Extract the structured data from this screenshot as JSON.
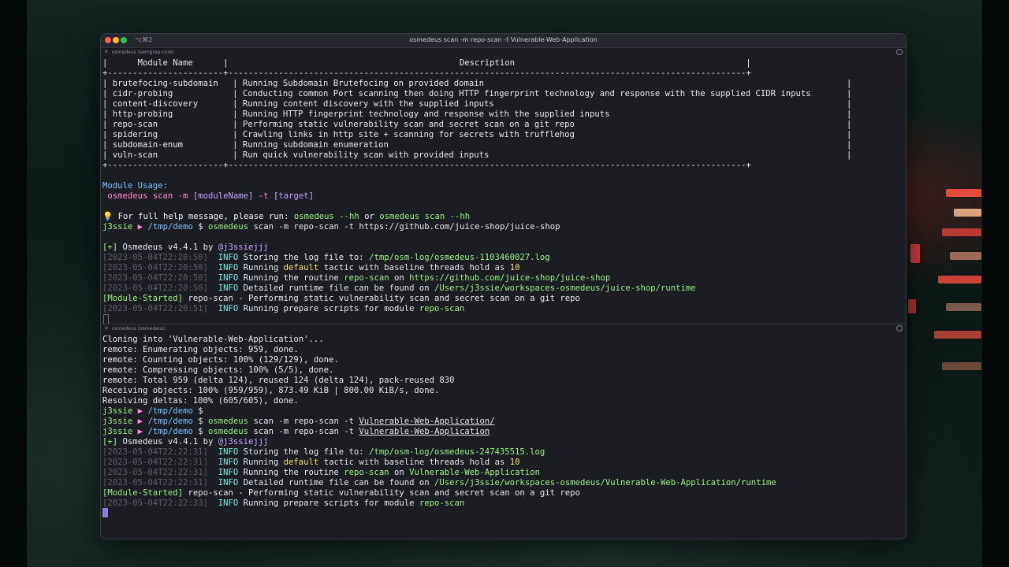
{
  "window": {
    "shortcut": "⌥⌘2",
    "title": "osmedeus scan -m repo-scan -t Vulnerable-Web-Application"
  },
  "pane1": {
    "name": "osmedeus (semgrep-core)",
    "table": {
      "border_top": "|      Module Name      |                                              Description                                              |",
      "separator": "+-----------------------+-------------------------------------------------------------------------------------------------------+",
      "rows": [
        {
          "name": "brutefocing-subdomain",
          "desc": "Running Subdomain Brutefocing on provided domain"
        },
        {
          "name": "cidr-probing",
          "desc": "Conducting common Port scanning then doing HTTP fingerprint technology and response with the supplied CIDR inputs"
        },
        {
          "name": "content-discovery",
          "desc": "Running content discovery with the supplied inputs"
        },
        {
          "name": "http-probing",
          "desc": "Running HTTP fingerprint technology and response with the supplied inputs"
        },
        {
          "name": "repo-scan",
          "desc": "Performing static vulnerability scan and secret scan on a git repo"
        },
        {
          "name": "spidering",
          "desc": "Crawling links in http site + scanning for secrets with trufflehog"
        },
        {
          "name": "subdomain-enum",
          "desc": "Running subdomain enumeration"
        },
        {
          "name": "vuln-scan",
          "desc": "Run quick vulnerability scan with provided inputs"
        }
      ]
    },
    "usage_label": "Module Usage:",
    "usage_cmd": "osmedeus scan -m",
    "usage_arg1": "[moduleName]",
    "usage_flag": "-t",
    "usage_arg2": "[target]",
    "help_prefix": "💡 For full help message, please run:",
    "help_cmd1": "osmedeus --hh",
    "help_or": "or",
    "help_cmd2": "osmedeus scan --hh",
    "prompt_user": "j3ssie",
    "prompt_arrow": "▶",
    "prompt_dir": "/tmp/demo",
    "prompt_dollar": "$",
    "cmd_name": "osmedeus",
    "cmd_args": "scan -m repo-scan -t https://github.com/juice-shop/juice-shop",
    "banner_plus": "[+]",
    "banner_text": "Osmedeus v4.4.1 by",
    "banner_author": "@j3ssiejjj",
    "logs": [
      {
        "ts": "[2023-05-04T22:20:50]",
        "level": "INFO",
        "pre": "Storing the log file to:",
        "hl": "/tmp/osm-log/osmedeus-1103460027.log",
        "post": ""
      },
      {
        "ts": "[2023-05-04T22:20:50]",
        "level": "INFO",
        "pre": "Running",
        "hl": "default",
        "post": "tactic with baseline threads hold as",
        "num": "10"
      },
      {
        "ts": "[2023-05-04T22:20:50]",
        "level": "INFO",
        "pre": "Running the routine",
        "hl": "repo-scan",
        "post": "on",
        "url": "https://github.com/juice-shop/juice-shop"
      },
      {
        "ts": "[2023-05-04T22:20:50]",
        "level": "INFO",
        "pre": "Detailed runtime file can be found on",
        "hl": "/Users/j3ssie/workspaces-osmedeus/juice-shop/runtime",
        "post": ""
      }
    ],
    "module_started_tag": "[Module-Started]",
    "module_started_text": "repo-scan - Performing static vulnerability scan and secret scan on a git repo",
    "last_log": {
      "ts": "[2023-05-04T22:20:51]",
      "level": "INFO",
      "pre": "Running prepare scripts for module",
      "hl": "repo-scan"
    }
  },
  "pane2": {
    "name": "osmedeus (osmedeus)",
    "git_lines": [
      "Cloning into 'Vulnerable-Web-Application'...",
      "remote: Enumerating objects: 959, done.",
      "remote: Counting objects: 100% (129/129), done.",
      "remote: Compressing objects: 100% (5/5), done.",
      "remote: Total 959 (delta 124), reused 124 (delta 124), pack-reused 830",
      "Receiving objects: 100% (959/959), 873.49 KiB | 800.00 KiB/s, done.",
      "Resolving deltas: 100% (605/605), done."
    ],
    "cmd_args_1": "scan -m repo-scan -t",
    "target_1": "Vulnerable-Web-Application/",
    "target_2": "Vulnerable-Web-Application",
    "banner_plus": "[+]",
    "banner_text": "Osmedeus v4.4.1 by",
    "banner_author": "@j3ssiejjj",
    "logs": [
      {
        "ts": "[2023-05-04T22:22:31]",
        "level": "INFO",
        "pre": "Storing the log file to:",
        "hl": "/tmp/osm-log/osmedeus-247435515.log"
      },
      {
        "ts": "[2023-05-04T22:22:31]",
        "level": "INFO",
        "pre": "Running",
        "hl": "default",
        "post": "tactic with baseline threads hold as",
        "num": "10"
      },
      {
        "ts": "[2023-05-04T22:22:31]",
        "level": "INFO",
        "pre": "Running the routine",
        "hl": "repo-scan",
        "post": "on",
        "url": "Vulnerable-Web-Application"
      },
      {
        "ts": "[2023-05-04T22:22:31]",
        "level": "INFO",
        "pre": "Detailed runtime file can be found on",
        "hl": "/Users/j3ssie/workspaces-osmedeus/Vulnerable-Web-Application/runtime"
      }
    ],
    "module_started_tag": "[Module-Started]",
    "module_started_text": "repo-scan - Performing static vulnerability scan and secret scan on a git repo",
    "last_log": {
      "ts": "[2023-05-04T22:22:33]",
      "level": "INFO",
      "pre": "Running prepare scripts for module",
      "hl": "repo-scan"
    }
  }
}
